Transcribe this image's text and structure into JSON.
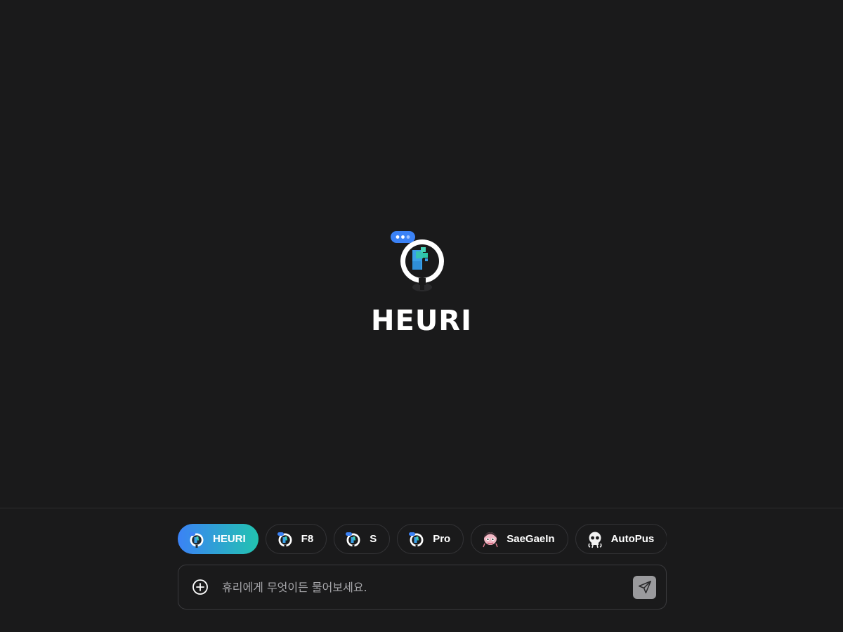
{
  "brand": {
    "title": "HEURI"
  },
  "models": [
    {
      "label": "HEURI",
      "icon": "heuri-logo-icon",
      "active": true
    },
    {
      "label": "F8",
      "icon": "heuri-f8-icon",
      "active": false
    },
    {
      "label": "S",
      "icon": "heuri-s-icon",
      "active": false
    },
    {
      "label": "Pro",
      "icon": "heuri-pro-icon",
      "active": false
    },
    {
      "label": "SaeGaeIn",
      "icon": "saegaein-avatar-icon",
      "active": false
    },
    {
      "label": "AutoPus",
      "icon": "autopus-skull-icon",
      "active": false
    }
  ],
  "composer": {
    "placeholder": "휴리에게 무엇이든 물어보세요.",
    "value": ""
  },
  "colors": {
    "background": "#1a1a1b",
    "accent_start": "#3b82f6",
    "accent_end": "#22c3b0",
    "send_button": "#9a9a9d"
  }
}
